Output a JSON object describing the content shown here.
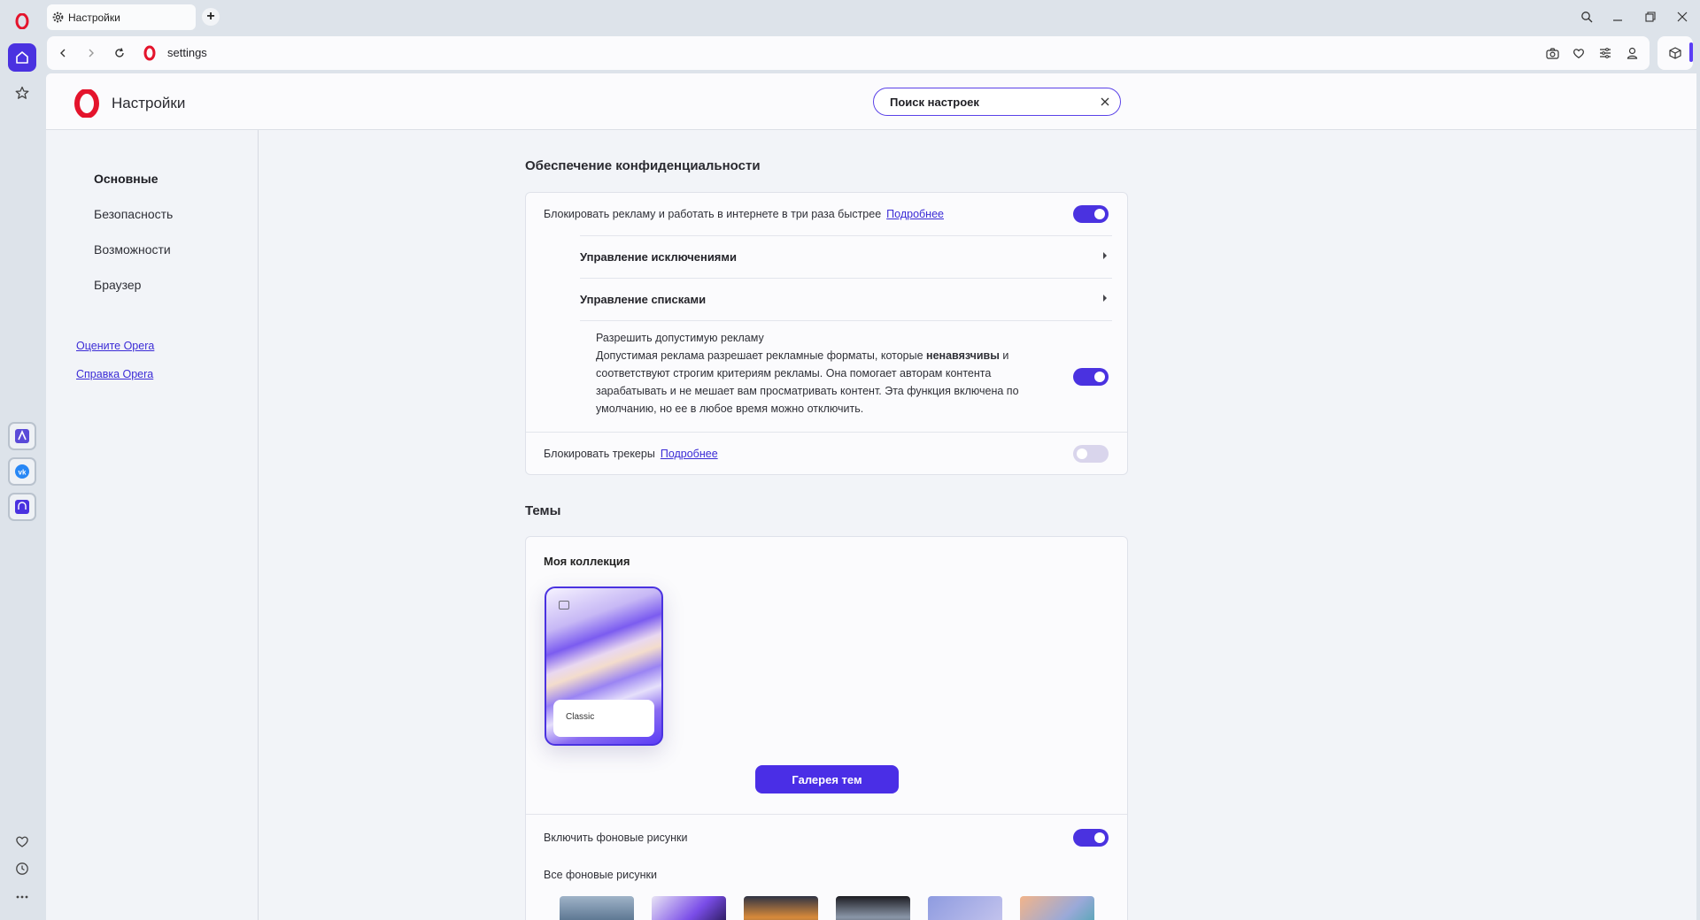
{
  "browser": {
    "tab_title": "Настройки",
    "address": "settings"
  },
  "settings": {
    "title": "Настройки",
    "search": {
      "placeholder": "Поиск настроек"
    },
    "nav": {
      "items": [
        "Основные",
        "Безопасность",
        "Возможности",
        "Браузер"
      ],
      "active": "Основные",
      "links": [
        "Оцените Opera",
        "Справка Opera"
      ]
    },
    "privacy": {
      "title": "Обеспечение конфиденциальности",
      "block_ads_label": "Блокировать рекламу и работать в интернете в три раза быстрее",
      "block_ads_link": "Подробнее",
      "manage_exceptions": "Управление исключениями",
      "manage_lists": "Управление списками",
      "acceptable_ads_title": "Разрешить допустимую рекламу",
      "acceptable_ads_desc_1": "Допустимая реклама разрешает рекламные форматы, которые ",
      "acceptable_ads_desc_bold": "ненавязчивы",
      "acceptable_ads_desc_2": " и соответствуют строгим критериям рекламы. Она помогает авторам контента зарабатывать и не мешает вам просматривать контент. Эта функция включена по умолчанию, но ее в любое время можно отключить.",
      "block_trackers_label": "Блокировать трекеры",
      "block_trackers_link": "Подробнее",
      "toggles": {
        "block_ads": true,
        "acceptable_ads": true,
        "block_trackers": false
      }
    },
    "themes": {
      "title": "Темы",
      "collection_title": "Моя коллекция",
      "theme_name": "Classic",
      "gallery_button": "Галерея тем",
      "bg_toggle_label": "Включить фоновые рисунки",
      "bg_toggle": true,
      "all_backgrounds_label": "Все фоновые рисунки"
    }
  },
  "colors": {
    "accent": "#4a32e0",
    "link": "#3b2bd6",
    "opera_red": "#e4142c"
  }
}
